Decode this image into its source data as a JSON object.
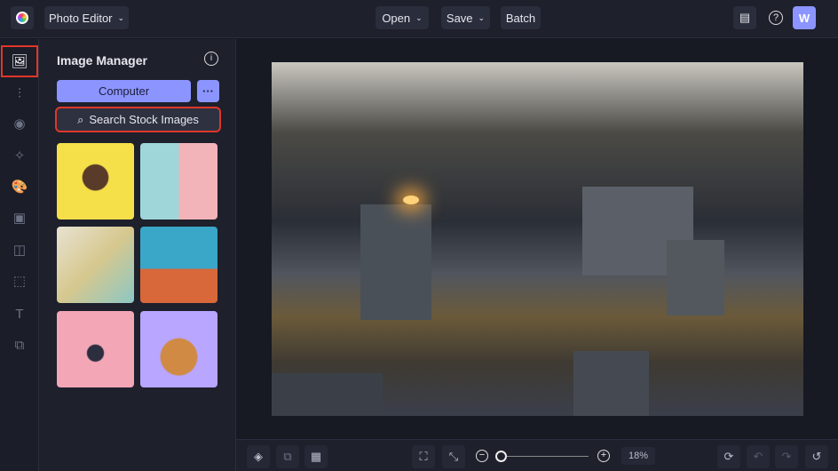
{
  "header": {
    "app_menu": "Photo Editor",
    "open": "Open",
    "save": "Save",
    "batch": "Batch",
    "avatar": "W"
  },
  "panel": {
    "title": "Image Manager",
    "computer": "Computer",
    "more": "···",
    "search_stock": "Search Stock Images"
  },
  "zoom": {
    "value": "18%",
    "fraction": 0.02
  },
  "colors": {
    "accent": "#8c95ff",
    "highlight": "#e0372a"
  }
}
